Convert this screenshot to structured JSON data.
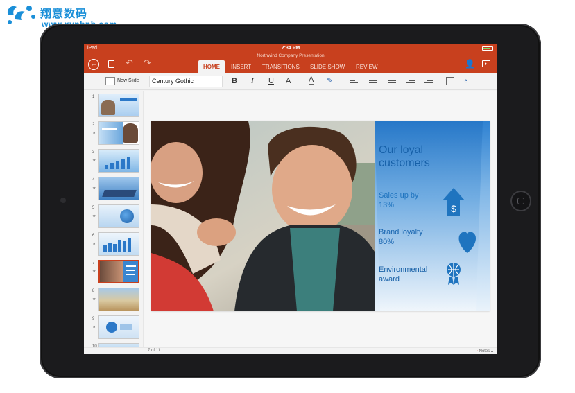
{
  "watermark": {
    "brand": "翔意数码",
    "url": "www.xynbnb.com"
  },
  "status_bar": {
    "device": "iPad",
    "time": "2:34 PM",
    "battery_level": 0.85
  },
  "document": {
    "title": "Northwind Company Presentation"
  },
  "header_icons": [
    "back-arrow-icon",
    "file-icon",
    "undo-icon",
    "redo-icon",
    "add-person-icon",
    "present-icon"
  ],
  "tabs": [
    {
      "label": "HOME",
      "active": true
    },
    {
      "label": "INSERT",
      "active": false
    },
    {
      "label": "TRANSITIONS",
      "active": false
    },
    {
      "label": "SLIDE SHOW",
      "active": false
    },
    {
      "label": "REVIEW",
      "active": false
    }
  ],
  "toolbar": {
    "new_slide_label": "New Slide",
    "font_value": "Century Gothic",
    "bold": "B",
    "italic": "I",
    "underline": "U",
    "text_effects": "A",
    "font_color": "A"
  },
  "thumbnails": {
    "numbers": [
      "1",
      "2",
      "3",
      "4",
      "5",
      "6",
      "7",
      "8",
      "9",
      "10"
    ],
    "selected": "7"
  },
  "slide": {
    "title": "Our loyal customers",
    "title_line1": "Our loyal",
    "title_line2": "customers",
    "stats": [
      {
        "line1": "Sales up by",
        "line2": "13%",
        "icon": "dollar-arrow-icon"
      },
      {
        "line1": "Brand loyalty",
        "line2": "80%",
        "icon": "heart-icon"
      },
      {
        "line1": "Environmental",
        "line2": "award",
        "icon": "globe-award-icon"
      }
    ]
  },
  "footer": {
    "page_count": "7 of 11",
    "notes_label": "Notes"
  },
  "colors": {
    "accent": "#c8401e",
    "slide_blue": "#1f74bf",
    "frame": "#1b1b1d"
  }
}
